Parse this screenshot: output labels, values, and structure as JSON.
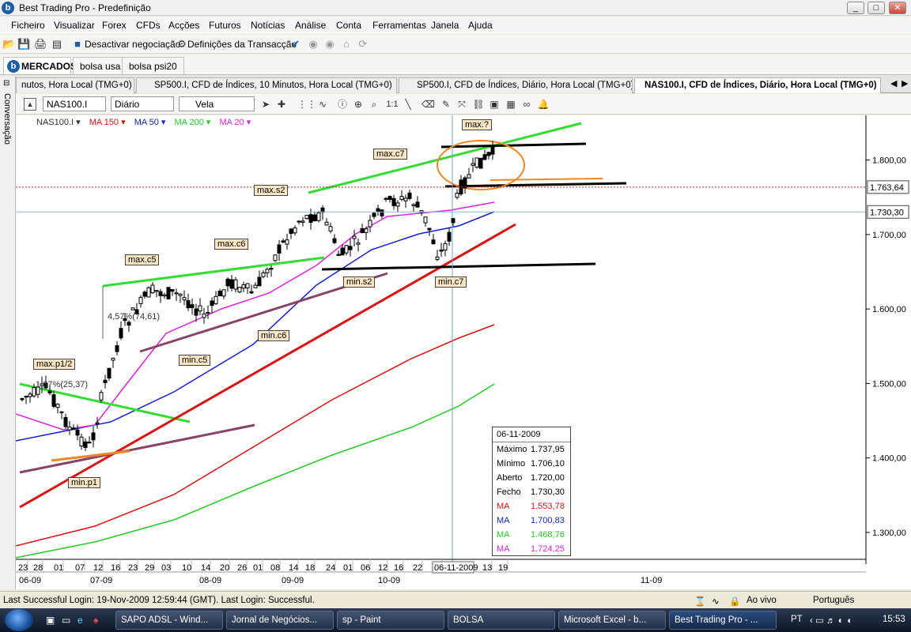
{
  "window": {
    "title": "Best Trading Pro - Predefinição",
    "logo_letter": "b",
    "buttons": [
      "_",
      "□",
      "✕"
    ]
  },
  "menu": [
    "Ficheiro",
    "Visualizar",
    "Forex",
    "CFDs",
    "Acções",
    "Futuros",
    "Notícias",
    "Análise",
    "Conta",
    "Ferramentas",
    "Janela",
    "Ajuda"
  ],
  "toolbar": {
    "disable_trading": "Desactivar negociação",
    "transaction_settings": "Definições da Transacção",
    "icons": [
      "open-icon",
      "save-icon",
      "print-icon",
      "print-preview-icon",
      "stop-icon",
      "settings-icon",
      "check-icon",
      "circle-icon",
      "circle-icon-2",
      "home-icon",
      "refresh-icon"
    ]
  },
  "market_tabs": {
    "logo_letter": "b",
    "active": "MERCADOS",
    "others": [
      "bolsa usa",
      "bolsa psi20"
    ]
  },
  "sidebar": {
    "label": "Conversação"
  },
  "chart_tabs": [
    "nutos, Hora Local (TMG+0)",
    "SP500.I, CFD de Índices, 10 Minutos, Hora Local (TMG+0)",
    "SP500.I, CFD de Índices, Diário, Hora Local (TMG+0)",
    "NAS100.I, CFD de Índices, Diário, Hora Local (TMG+0)"
  ],
  "chart_toolbar": {
    "symbol": "NAS100.I",
    "period": "Diário",
    "chart_type": "Vela",
    "zoom_label": "1:1"
  },
  "legend": [
    {
      "label": "NAS100.I",
      "color": "#333333"
    },
    {
      "label": "MA 150",
      "color": "#dd1111"
    },
    {
      "label": "MA 50",
      "color": "#1122cc"
    },
    {
      "label": "MA 200",
      "color": "#22cc22"
    },
    {
      "label": "MA 20",
      "color": "#dd22dd"
    }
  ],
  "chart_data": {
    "type": "candlestick",
    "symbol": "NAS100.I",
    "y_ticks": [
      "1.800,00",
      "1.700,00",
      "1.600,00",
      "1.500,00",
      "1.400,00",
      "1.300,00"
    ],
    "y_tick_values": [
      1800,
      1700,
      1600,
      1500,
      1400,
      1300
    ],
    "ylim": [
      1266,
      1860
    ],
    "price_marker_red": "1.763,64",
    "price_marker_blue": "1.730,30",
    "price_marker_red_value": 1763.64,
    "price_marker_blue_value": 1730.3,
    "x_day_ticks": [
      "23",
      "28",
      "01",
      "07",
      "12",
      "16",
      "23",
      "29",
      "03",
      "10",
      "14",
      "20",
      "26",
      "01",
      "08",
      "14",
      "18",
      "24",
      "01",
      "06",
      "12",
      "16",
      "22",
      "2",
      "13",
      "19"
    ],
    "x_month_labels": [
      "06-09",
      "07-09",
      "08-09",
      "09-09",
      "10-09",
      "11-09"
    ],
    "crosshair_date": "06-11-2009",
    "annotations": [
      "max.p1/2",
      "max.c5",
      "max.c6",
      "max.s2",
      "max.c7",
      "max.?",
      "min.p1",
      "min.c5",
      "min.c6",
      "min.s2",
      "min.c7",
      "4,57%(74,61)",
      "1,67%(25,37)"
    ],
    "series": [
      {
        "name": "MA 150",
        "color": "#dd1111"
      },
      {
        "name": "MA 50",
        "color": "#1122cc"
      },
      {
        "name": "MA 200",
        "color": "#22cc22"
      },
      {
        "name": "MA 20",
        "color": "#dd22dd"
      }
    ]
  },
  "info_box": {
    "date": "06-11-2009",
    "rows": [
      {
        "label": "Máximo",
        "value": "1.737,95",
        "color": "#000000"
      },
      {
        "label": "Mínimo",
        "value": "1.706,10",
        "color": "#000000"
      },
      {
        "label": "Aberto",
        "value": "1.720,00",
        "color": "#000000"
      },
      {
        "label": "Fecho",
        "value": "1.730,30",
        "color": "#000000"
      },
      {
        "label": "MA",
        "value": "1.553,78",
        "color": "#dd1111"
      },
      {
        "label": "MA",
        "value": "1.700,83",
        "color": "#1122cc"
      },
      {
        "label": "MA",
        "value": "1.468,76",
        "color": "#22cc22"
      },
      {
        "label": "MA",
        "value": "1.724,25",
        "color": "#dd22dd"
      }
    ]
  },
  "status": {
    "login": "Last Successful Login: 19-Nov-2009 12:59:44 (GMT). Last Login: Successful.",
    "mode": "Ao vivo",
    "language": "Português"
  },
  "taskbar": {
    "items": [
      "SAPO ADSL - Wind...",
      "Jornal de Negócios...",
      "sp - Paint",
      "BOLSA",
      "Microsoft Excel - b...",
      "Best Trading Pro - ..."
    ],
    "lang": "PT",
    "clock": "15:53"
  }
}
